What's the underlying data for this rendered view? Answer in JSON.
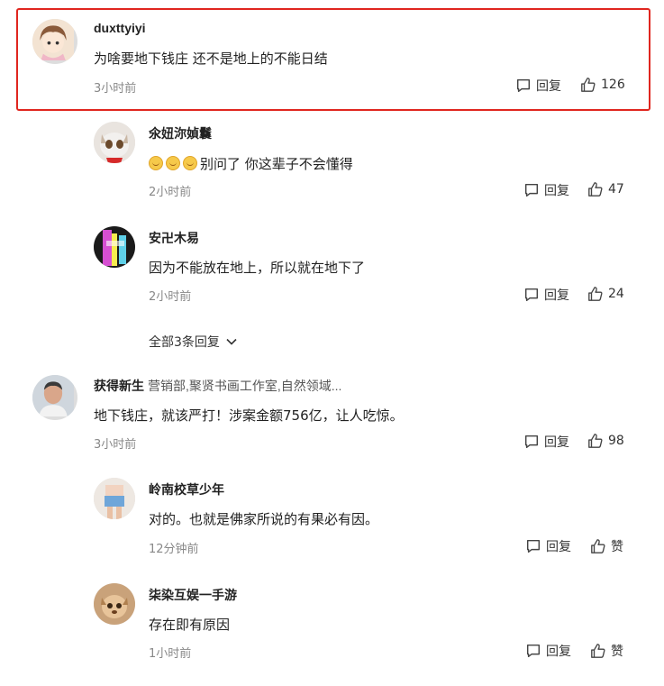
{
  "comments": [
    {
      "user": "duxttyiyi",
      "text": "为啥要地下钱庄 还不是地上的不能日结",
      "time": "3小时前",
      "reply_label": "回复",
      "like_count": "126"
    },
    {
      "user": "氽妞沵媜鬤",
      "text": "别问了 你这辈子不会懂得",
      "time": "2小时前",
      "reply_label": "回复",
      "like_count": "47"
    },
    {
      "user": "安卍木易",
      "text": "因为不能放在地上，所以就在地下了",
      "time": "2小时前",
      "reply_label": "回复",
      "like_count": "24"
    },
    {
      "user": "获得新生",
      "user_desc": "营销部,聚贤书画工作室,自然领域...",
      "text": "地下钱庄，就该严打！涉案金额756亿，让人吃惊。",
      "time": "3小时前",
      "reply_label": "回复",
      "like_count": "98"
    },
    {
      "user": "岭南校草少年",
      "text": "对的。也就是佛家所说的有果必有因。",
      "time": "12分钟前",
      "reply_label": "回复",
      "like_count": "赞"
    },
    {
      "user": "柒染互娱一手游",
      "text": "存在即有原因",
      "time": "1小时前",
      "reply_label": "回复",
      "like_count": "赞"
    }
  ],
  "more_replies": "全部3条回复",
  "icons": {
    "reply": "comment-bubble-icon",
    "like": "thumbs-up-icon",
    "expand": "chevron-down-icon"
  },
  "colors": {
    "highlight_border": "#e0261f",
    "meta_text": "#888888"
  }
}
